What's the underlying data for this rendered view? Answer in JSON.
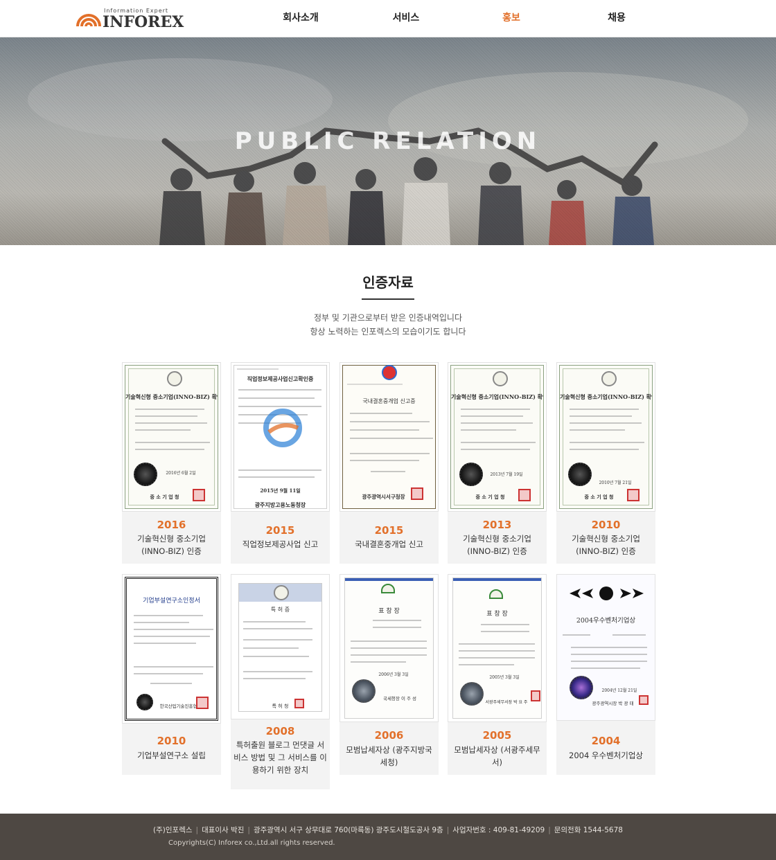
{
  "header": {
    "logo": {
      "tagline": "Information Expert",
      "wordmark": "INFOREX"
    },
    "nav": [
      {
        "label": "회사소개",
        "active": false
      },
      {
        "label": "서비스",
        "active": false
      },
      {
        "label": "홍보",
        "active": true
      },
      {
        "label": "채용",
        "active": false
      }
    ]
  },
  "hero": {
    "title": "PUBLIC RELATION"
  },
  "section": {
    "title": "인증자료",
    "desc_line1": "정부 및 기관으로부터 받은 인증내역입니다",
    "desc_line2": "항상 노력하는 인포렉스의 모습이기도 합니다"
  },
  "cards": [
    {
      "year": "2016",
      "caption": "기술혁신형 중소기업 (INNO-BIZ) 인증",
      "cert_title": "기술혁신형 중소기업(INNO-BIZ) 확인서",
      "cert_issuer": "중 소 기 업 청",
      "cert_date": "2016년 6월 2일"
    },
    {
      "year": "2015",
      "caption": "직업정보제공사업 신고",
      "cert_title": "직업정보제공사업신고확인증",
      "cert_issuer": "광주지방고용노동청장",
      "cert_date": "2015년 9월 11일"
    },
    {
      "year": "2015",
      "caption": "국내결혼중개업 신고",
      "cert_title": "국내결혼중개업 신고증",
      "cert_issuer": "광주광역시서구청장",
      "cert_date": ""
    },
    {
      "year": "2013",
      "caption": "기술혁신형 중소기업 (INNO-BIZ) 인증",
      "cert_title": "기술혁신형 중소기업(INNO-BIZ) 확인서",
      "cert_issuer": "중 소 기 업 청",
      "cert_date": "2013년 7월 19일"
    },
    {
      "year": "2010",
      "caption": "기술혁신형 중소기업 (INNO-BIZ) 인증",
      "cert_title": "기술혁신형 중소기업(INNO-BIZ) 확인서",
      "cert_issuer": "중 소 기 업 청",
      "cert_date": "2010년 7월 21일"
    },
    {
      "year": "2010",
      "caption": "기업부설연구소 설립",
      "cert_title": "기업부설연구소인정서",
      "cert_issuer": "한국산업기술진흥협회장",
      "cert_date": ""
    },
    {
      "year": "2008",
      "caption": "특허출원 블로그 먼댓글 서비스 방법 및 그 서비스를 이용하기 위한 장치",
      "cert_title": "특 허 증",
      "cert_issuer": "특 허 청",
      "cert_date": ""
    },
    {
      "year": "2006",
      "caption": "모범납세자상 (광주지방국세청)",
      "cert_title": "표 창 장",
      "cert_issuer": "국세청장 이 주 성",
      "cert_date": "2006년 3월 3일"
    },
    {
      "year": "2005",
      "caption": "모범납세자상 (서광주세무서)",
      "cert_title": "표 창 장",
      "cert_issuer": "서광주세무서장 박 요 주",
      "cert_date": "2005년 3월 3일"
    },
    {
      "year": "2004",
      "caption": "2004 우수벤처기업상",
      "cert_title": "2004우수벤처기업상",
      "cert_issuer": "광주광역시장 박 광 태",
      "cert_date": "2004년 12월 21일"
    }
  ],
  "footer": {
    "company": "(주)인포렉스",
    "ceo": "대표이사 박진",
    "address": "광주광역시 서구 상무대로 760(마륵동) 광주도시철도공사 9층",
    "biz_no": "사업자번호 : 409-81-49209",
    "phone": "문의전화 1544-5678",
    "copyright": "Copyrights(C) Inforex co.,Ltd.all rights reserved."
  }
}
